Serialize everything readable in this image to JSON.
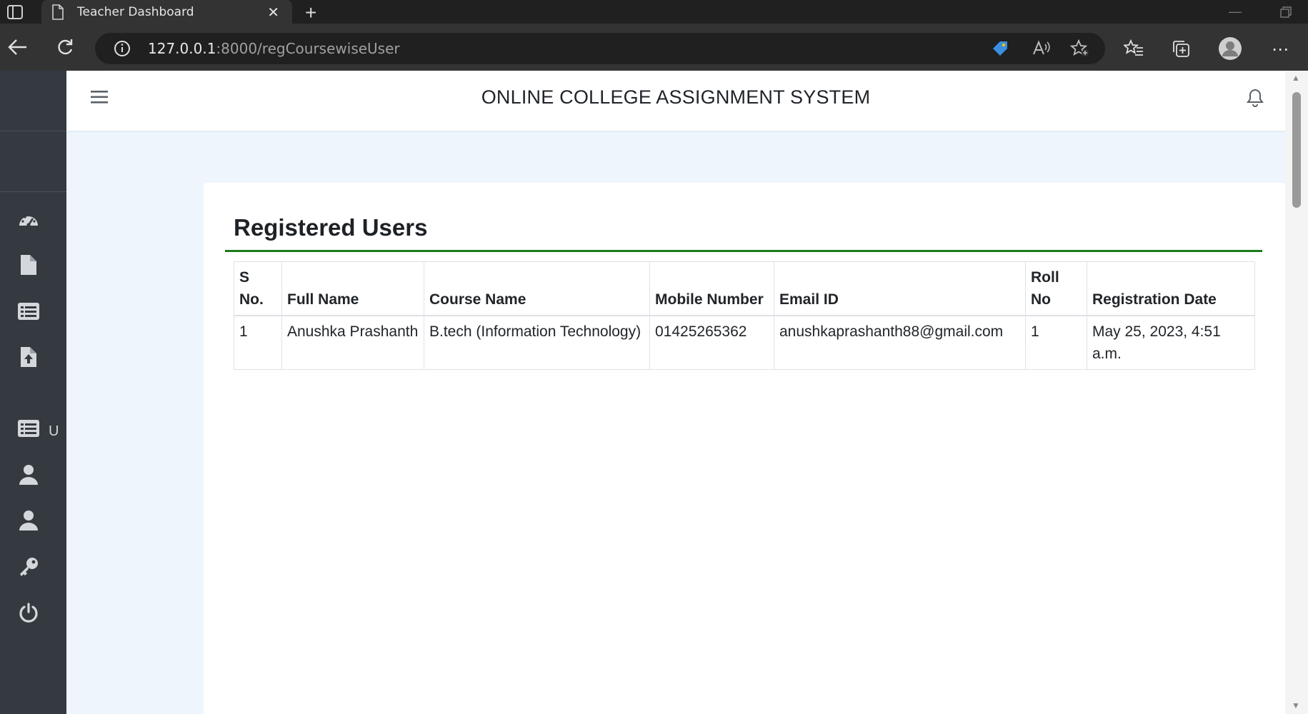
{
  "browser": {
    "tab_title": "Teacher Dashboard",
    "url_host": "127.0.0.1",
    "url_rest": ":8000/regCoursewiseUser"
  },
  "sidebar": {
    "items": [
      {
        "icon": "dashboard-gauge-icon"
      },
      {
        "icon": "file-icon"
      },
      {
        "icon": "list-icon"
      },
      {
        "icon": "file-upload-icon",
        "label": "U"
      },
      {
        "icon": "list-icon"
      },
      {
        "icon": "user-icon"
      },
      {
        "icon": "user-icon"
      },
      {
        "icon": "key-icon"
      },
      {
        "icon": "power-icon"
      }
    ]
  },
  "header": {
    "title": "ONLINE COLLEGE ASSIGNMENT SYSTEM"
  },
  "card": {
    "title": "Registered Users"
  },
  "table": {
    "columns": [
      "S No.",
      "Full Name",
      "Course Name",
      "Mobile Number",
      "Email ID",
      "Roll No",
      "Registration Date"
    ],
    "rows": [
      [
        "1",
        "Anushka Prashanth",
        "B.tech (Information Technology)",
        "01425265362",
        "anushkaprashanth88@gmail.com",
        "1",
        "May 25, 2023, 4:51 a.m."
      ]
    ]
  },
  "colors": {
    "sidebar_bg": "#343a40",
    "main_bg": "#eef5fd",
    "accent_rule": "#1b7a1b"
  }
}
